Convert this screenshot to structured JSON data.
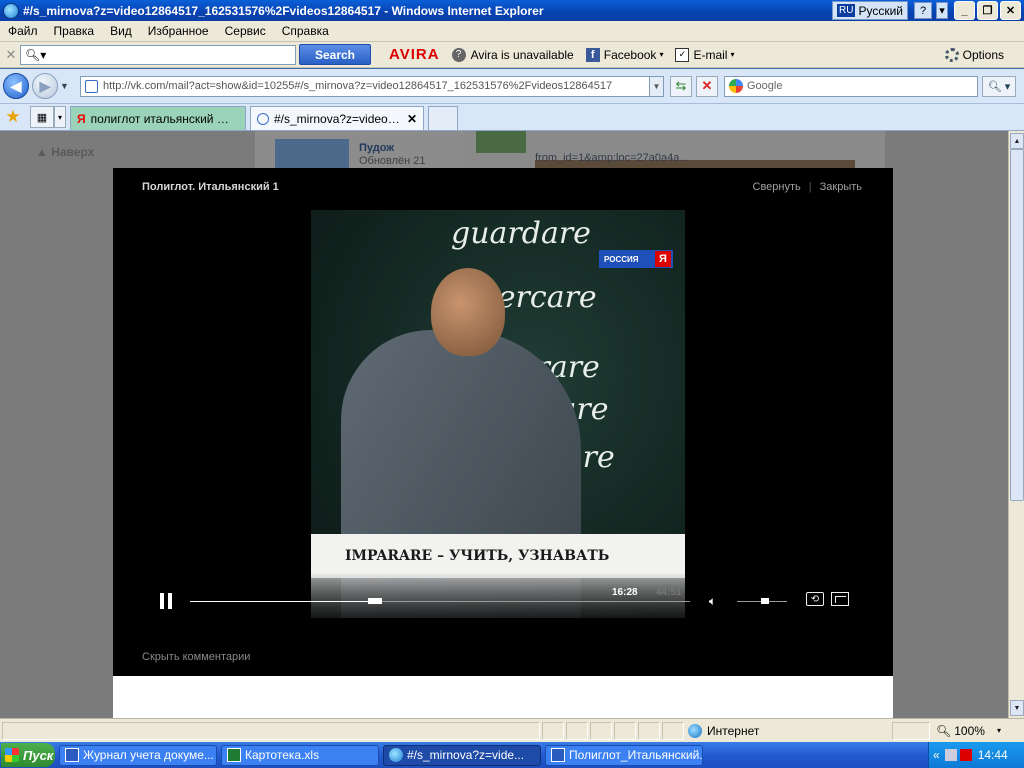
{
  "window": {
    "title": "#/s_mirnova?z=video12864517_162531576%2Fvideos12864517 - Windows Internet Explorer",
    "lang_code": "RU",
    "lang_name": "Русский",
    "help": "?"
  },
  "menu": [
    "Файл",
    "Правка",
    "Вид",
    "Избранное",
    "Сервис",
    "Справка"
  ],
  "toolbar": {
    "search_button": "Search",
    "avira": "AVIRA",
    "avira_status": "Avira is unavailable",
    "facebook": "Facebook",
    "email": "E-mail",
    "options": "Options"
  },
  "address": {
    "url": "http://vk.com/mail?act=show&id=10255#/s_mirnova?z=video12864517_162531576%2Fvideos12864517",
    "search_placeholder": "Google"
  },
  "tabs": [
    {
      "label": "полиглот итальянский — Я...",
      "active": false
    },
    {
      "label": "#/s_mirnova?z=video12...",
      "active": true
    }
  ],
  "page": {
    "back_top": "Наверх",
    "item_title": "Пудож",
    "item_subtitle": "Обновлён 21",
    "link_text_1": "from_id=1&amp;loc=27a0a4a..."
  },
  "video": {
    "title": "Полиглот. Итальянский 1",
    "minimize": "Свернуть",
    "close": "Закрыть",
    "caption": "IMPARARE –  УЧИТЬ, УЗНАВАТЬ",
    "channel": "РОССИЯ",
    "current_time": "16:28",
    "total_time": "44:51",
    "progress": 0.37,
    "volume": 0.55,
    "board_words": [
      "guardare",
      "cercare",
      "lavorare",
      "imparare",
      "ascoltare"
    ],
    "hide_comments": "Скрыть комментарии"
  },
  "status": {
    "zone": "Интернет",
    "zoom": "100%"
  },
  "taskbar": {
    "start": "Пуск",
    "items": [
      {
        "label": "Журнал учета докуме...",
        "icon": "word-icon",
        "active": false
      },
      {
        "label": "Картотека.xls",
        "icon": "excel-icon",
        "active": false
      },
      {
        "label": "#/s_mirnova?z=vide...",
        "icon": "ie-icon",
        "active": true
      },
      {
        "label": "Полиглот_Итальянский...",
        "icon": "word-icon",
        "active": false
      }
    ],
    "clock": "14:44"
  }
}
